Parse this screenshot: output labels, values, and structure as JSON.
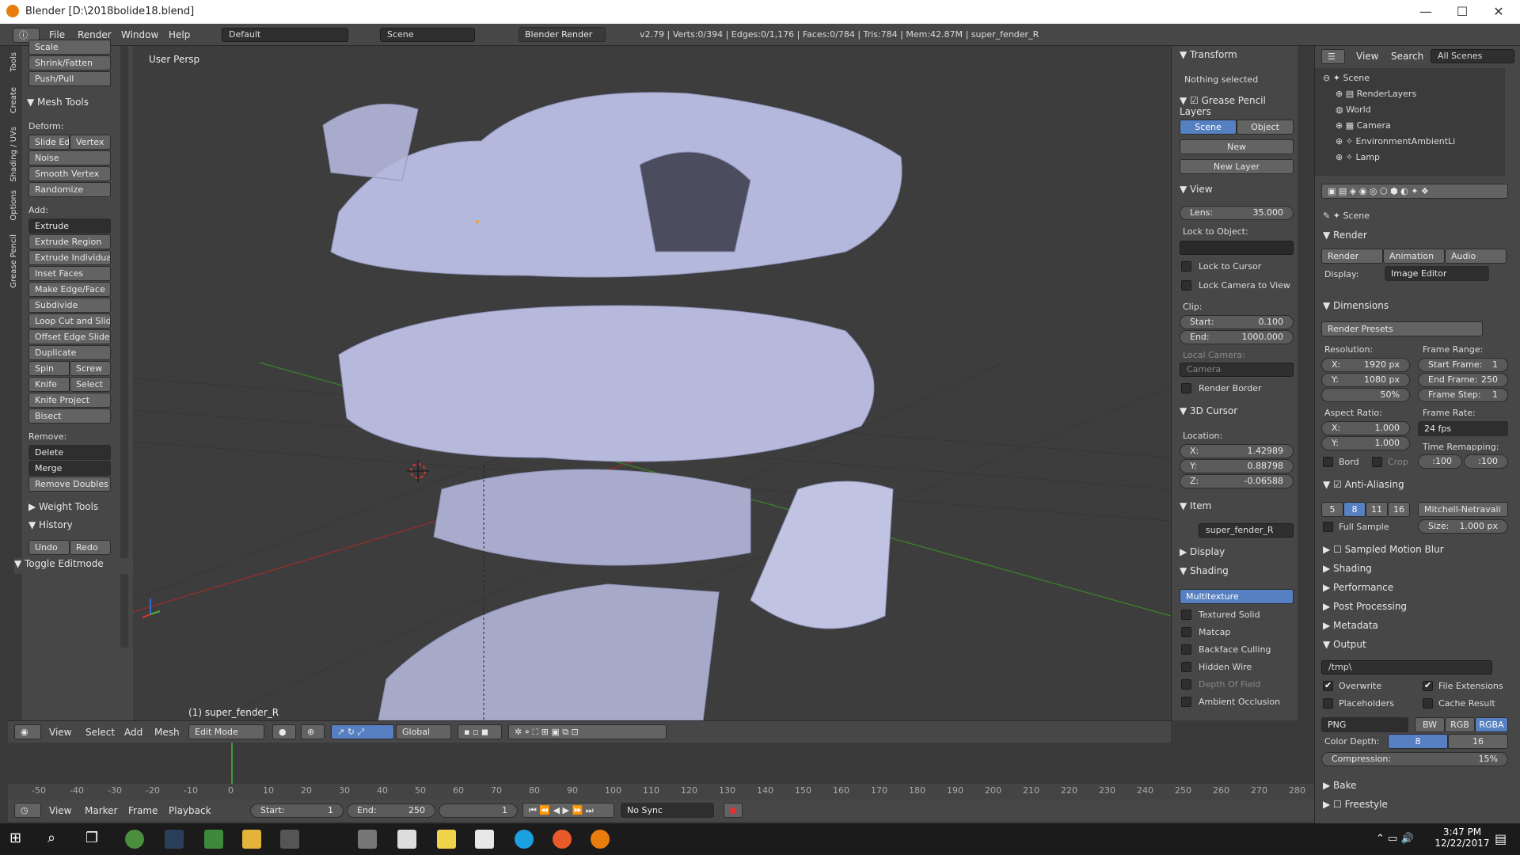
{
  "window": {
    "title": "Blender [D:\\2018bolide18.blend]",
    "min": "—",
    "max": "☐",
    "close": "✕"
  },
  "info": {
    "menus": [
      "File",
      "Render",
      "Window",
      "Help"
    ],
    "screen": "Default",
    "scene": "Scene",
    "engine": "Blender Render",
    "stats": "v2.79 | Verts:0/394 | Edges:0/1,176 | Faces:0/784 | Tris:784 | Mem:42.87M | super_fender_R"
  },
  "tabs": [
    "Tools",
    "Create",
    "Shading / UVs",
    "Options",
    "Grease Pencil"
  ],
  "tools": {
    "top": [
      "Scale",
      "Shrink/Fatten",
      "Push/Pull"
    ],
    "mesh_tools": "Mesh Tools",
    "deform_label": "Deform:",
    "deform": [
      [
        "Slide Ed",
        "Vertex"
      ],
      [
        "Noise"
      ],
      [
        "Smooth Vertex"
      ],
      [
        "Randomize"
      ]
    ],
    "add_label": "Add:",
    "extrude": "Extrude",
    "add": [
      "Extrude Region",
      "Extrude Individual",
      "Inset Faces",
      "Make Edge/Face",
      "Subdivide",
      "Loop Cut and Slide",
      "Offset Edge Slide",
      "Duplicate"
    ],
    "pairs": [
      [
        "Spin",
        "Screw"
      ],
      [
        "Knife",
        "Select"
      ]
    ],
    "add2": [
      "Knife Project",
      "Bisect"
    ],
    "remove_label": "Remove:",
    "delete": "Delete",
    "merge": "Merge",
    "remove_doubles": "Remove Doubles",
    "weight_tools": "Weight Tools",
    "history": "History",
    "undo": "Undo",
    "redo": "Redo",
    "toggle_editmode": "Toggle Editmode"
  },
  "viewport": {
    "label": "User Persp",
    "object": "(1) super_fender_R"
  },
  "viewheader": {
    "menus": [
      "View",
      "Select",
      "Add",
      "Mesh"
    ],
    "mode": "Edit Mode",
    "orientation": "Global"
  },
  "props": {
    "transform": "Transform",
    "nothing_selected": "Nothing selected",
    "grease": "Grease Pencil Layers",
    "scene_btn": "Scene",
    "object_btn": "Object",
    "new": "New",
    "new_layer": "New Layer",
    "view": "View",
    "lens_label": "Lens:",
    "lens": "35.000",
    "lock_obj": "Lock to Object:",
    "lock_cursor": "Lock to Cursor",
    "lock_cam": "Lock Camera to View",
    "clip": "Clip:",
    "start_label": "Start:",
    "start": "0.100",
    "end_label": "End:",
    "end": "1000.000",
    "local_camera": "Local Camera:",
    "camera": "Camera",
    "render_border": "Render Border",
    "cursor": "3D Cursor",
    "location": "Location:",
    "x": "1.42989",
    "y": "0.88798",
    "z": "-0.06588",
    "item": "Item",
    "item_name": "super_fender_R",
    "display": "Display",
    "shading": "Shading",
    "multitexture": "Multitexture",
    "shade_opts": [
      "Textured Solid",
      "Matcap",
      "Backface Culling",
      "Hidden Wire",
      "Depth Of Field",
      "Ambient Occlusion"
    ]
  },
  "outliner": {
    "menus": [
      "View",
      "Search"
    ],
    "filter": "All Scenes",
    "items": [
      "Scene",
      "RenderLayers",
      "World",
      "Camera",
      "EnvironmentAmbientLi",
      "Lamp"
    ]
  },
  "render": {
    "scene": "Scene",
    "render": "Render",
    "render_btn": "Render",
    "animation": "Animation",
    "audio": "Audio",
    "display": "Display:",
    "display_val": "Image Editor",
    "dimensions": "Dimensions",
    "presets": "Render Presets",
    "resolution": "Resolution:",
    "frame_range": "Frame Range:",
    "resx": "1920 px",
    "resy": "1080 px",
    "pct": "50%",
    "start_frame": "1",
    "end_frame": "250",
    "frame_step": "1",
    "aspect": "Aspect Ratio:",
    "frame_rate": "Frame Rate:",
    "ax": "1.000",
    "ay": "1.000",
    "fps": "24 fps",
    "bord": "Bord",
    "crop": "Crop",
    "remap": "Time Remapping:",
    "r1": ":100",
    "r2": ":100",
    "aa": "Anti-Aliasing",
    "aa_vals": [
      "5",
      "8",
      "11",
      "16"
    ],
    "filter": "Mitchell-Netravali",
    "full_sample": "Full Sample",
    "size": "Size:",
    "size_val": "1.000 px",
    "sections": [
      "Sampled Motion Blur",
      "Shading",
      "Performance",
      "Post Processing",
      "Metadata"
    ],
    "output": "Output",
    "path": "/tmp\\",
    "overwrite": "Overwrite",
    "file_ext": "File Extensions",
    "placeholders": "Placeholders",
    "cache": "Cache Result",
    "format": "PNG",
    "bw": "BW",
    "rgb": "RGB",
    "rgba": "RGBA",
    "depth": "Color Depth:",
    "d8": "8",
    "d16": "16",
    "compression": "Compression:",
    "comp_val": "15%",
    "bake": "Bake",
    "freestyle": "Freestyle"
  },
  "timeline": {
    "ticks": [
      "-50",
      "-40",
      "-30",
      "-20",
      "-10",
      "0",
      "10",
      "20",
      "30",
      "40",
      "50",
      "60",
      "70",
      "80",
      "90",
      "100",
      "110",
      "120",
      "130",
      "140",
      "150",
      "160",
      "170",
      "180",
      "190",
      "200",
      "210",
      "220",
      "230",
      "240",
      "250",
      "260",
      "270",
      "280"
    ],
    "menus": [
      "View",
      "Marker",
      "Frame",
      "Playback"
    ],
    "start": "Start:",
    "start_val": "1",
    "end": "End:",
    "end_val": "250",
    "current": "1",
    "sync": "No Sync"
  },
  "clock": {
    "time": "3:47 PM",
    "date": "12/22/2017"
  },
  "colors": {
    "accent": "#5680c2",
    "mesh": "#b4b8dc",
    "bg": "#3d3d3d"
  }
}
